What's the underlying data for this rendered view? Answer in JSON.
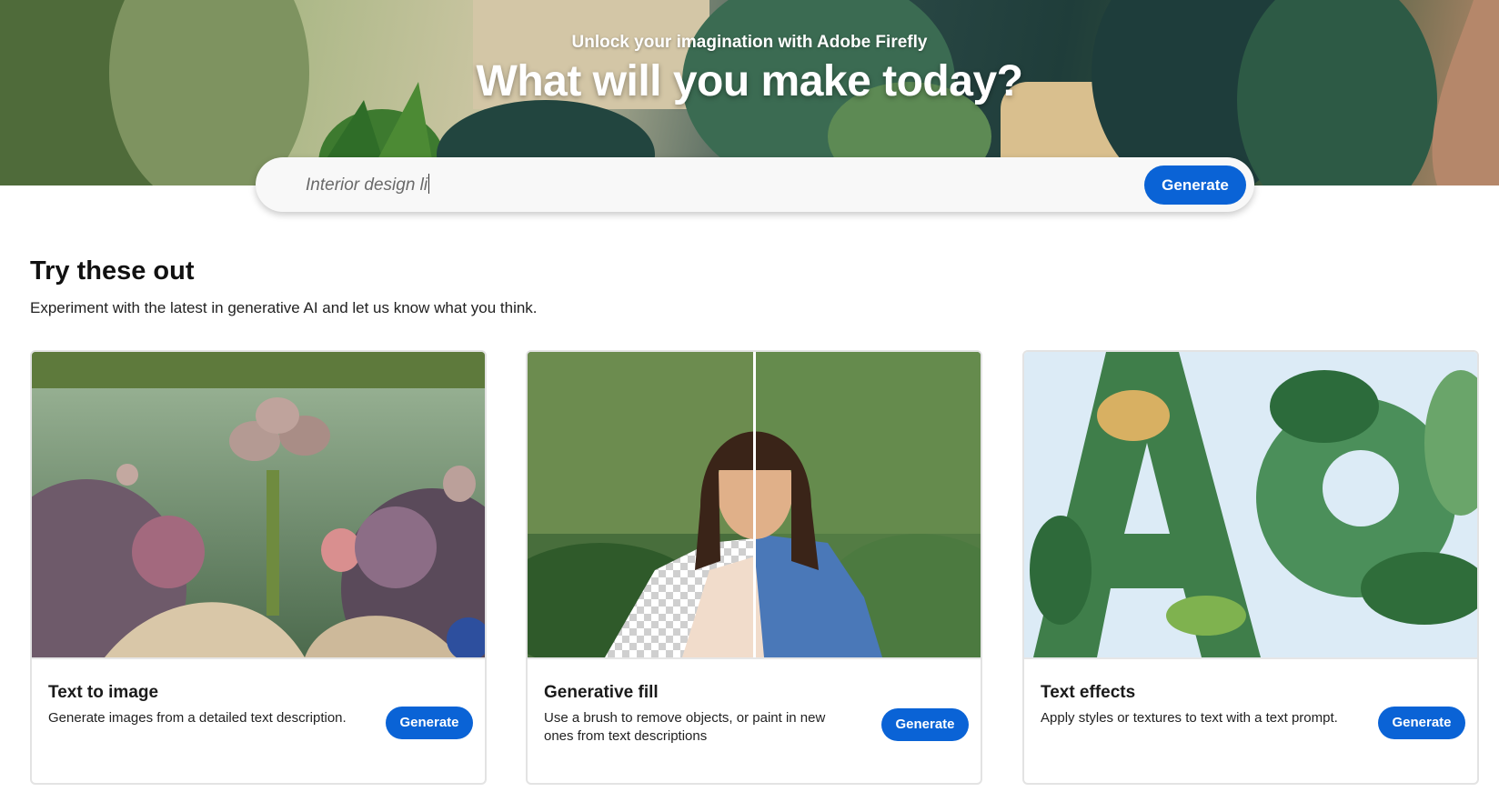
{
  "hero": {
    "subtitle": "Unlock your imagination with Adobe Firefly",
    "title": "What will you make today?"
  },
  "prompt": {
    "value": "Interior design li",
    "button_label": "Generate"
  },
  "section": {
    "title": "Try these out",
    "subtitle": "Experiment with the latest in generative AI and let us know what you think."
  },
  "cards": [
    {
      "title": "Text to image",
      "description": "Generate images from a detailed text description.",
      "button_label": "Generate",
      "image": "fantasy-garden-image"
    },
    {
      "title": "Generative fill",
      "description": "Use a brush to remove objects, or paint in new ones from text descriptions",
      "button_label": "Generate",
      "image": "portrait-generative-fill-image"
    },
    {
      "title": "Text effects",
      "description": "Apply styles or textures to text with a text prompt.",
      "button_label": "Generate",
      "image": "leafy-letters-image"
    }
  ],
  "colors": {
    "accent": "#0a63d6",
    "card_border": "#e3e3e3"
  }
}
